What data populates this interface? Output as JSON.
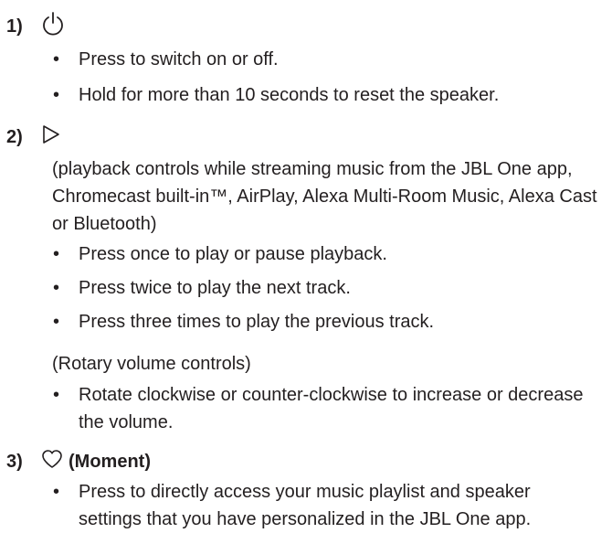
{
  "sections": [
    {
      "number": "1)",
      "icon": "power-icon",
      "bullets": [
        "Press to switch on or off.",
        "Hold for more than 10 seconds to reset the speaker."
      ]
    },
    {
      "number": "2)",
      "icon": "play-icon",
      "note1": "(playback controls while streaming music from the JBL One app, Chromecast built-in™, AirPlay, Alexa Multi-Room Music, Alexa Cast or Bluetooth)",
      "bullets": [
        "Press once to play or pause playback.",
        "Press twice to play the next track.",
        "Press three times to play the previous track."
      ],
      "note2": "(Rotary volume controls)",
      "bullets2": [
        "Rotate clockwise or counter-clockwise to increase or decrease the volume."
      ]
    },
    {
      "number": "3)",
      "icon": "heart-icon",
      "label": "(Moment)",
      "bullets": [
        "Press to directly access your music playlist and speaker settings that you have personalized in the JBL One app."
      ]
    }
  ],
  "bullet_char": "•"
}
